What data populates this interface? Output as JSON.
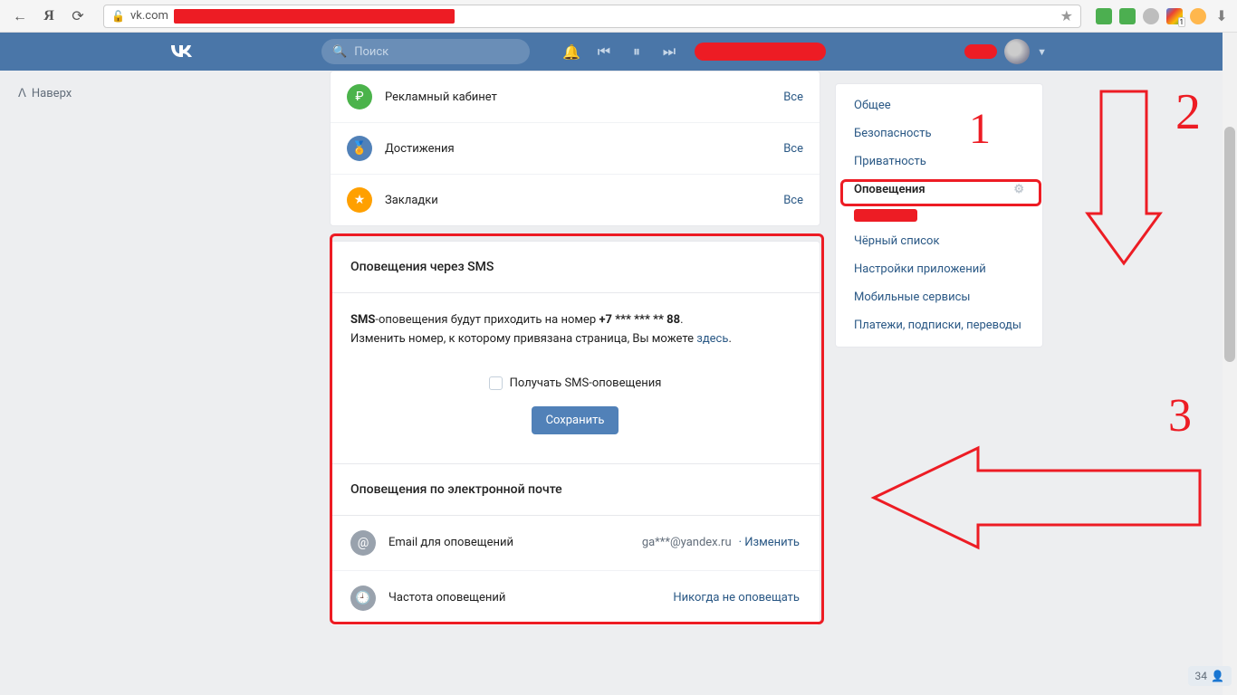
{
  "browser": {
    "url": "vk.com",
    "ext_colors": [
      "#4caf50",
      "#4caf50",
      "#bdbdbd",
      "#4285f4",
      "#ff9800",
      "#808080"
    ]
  },
  "header": {
    "search_placeholder": "Поиск"
  },
  "up": {
    "label": "Наверх"
  },
  "nav": [
    {
      "label": "Рекламный кабинет",
      "all": "Все"
    },
    {
      "label": "Достижения",
      "all": "Все"
    },
    {
      "label": "Закладки",
      "all": "Все"
    }
  ],
  "sms": {
    "header": "Оповещения через SMS",
    "prefix": "SMS",
    "body1": "-оповещения будут приходить на номер ",
    "phone": "+7 *** *** ** 88",
    "body1_end": ".",
    "body2": "Изменить номер, к которому привязана страница, Вы можете ",
    "link": "здесь",
    "body2_end": ".",
    "checkbox": "Получать SMS-оповещения",
    "save": "Сохранить"
  },
  "email": {
    "header": "Оповещения по электронной почте",
    "rows": [
      {
        "label": "Email для оповещений",
        "value": "ga***@yandex.ru",
        "action": "Изменить"
      },
      {
        "label": "Частота оповещений",
        "value": "",
        "action": "Никогда не оповещать"
      }
    ]
  },
  "right_menu": [
    "Общее",
    "Безопасность",
    "Приватность",
    "Оповещения",
    "Чёрный список",
    "Настройки приложений",
    "Мобильные сервисы",
    "Платежи, подписки, переводы"
  ],
  "anno": {
    "n1": "1",
    "n2": "2",
    "n3": "3"
  },
  "footer": {
    "count": "34"
  }
}
